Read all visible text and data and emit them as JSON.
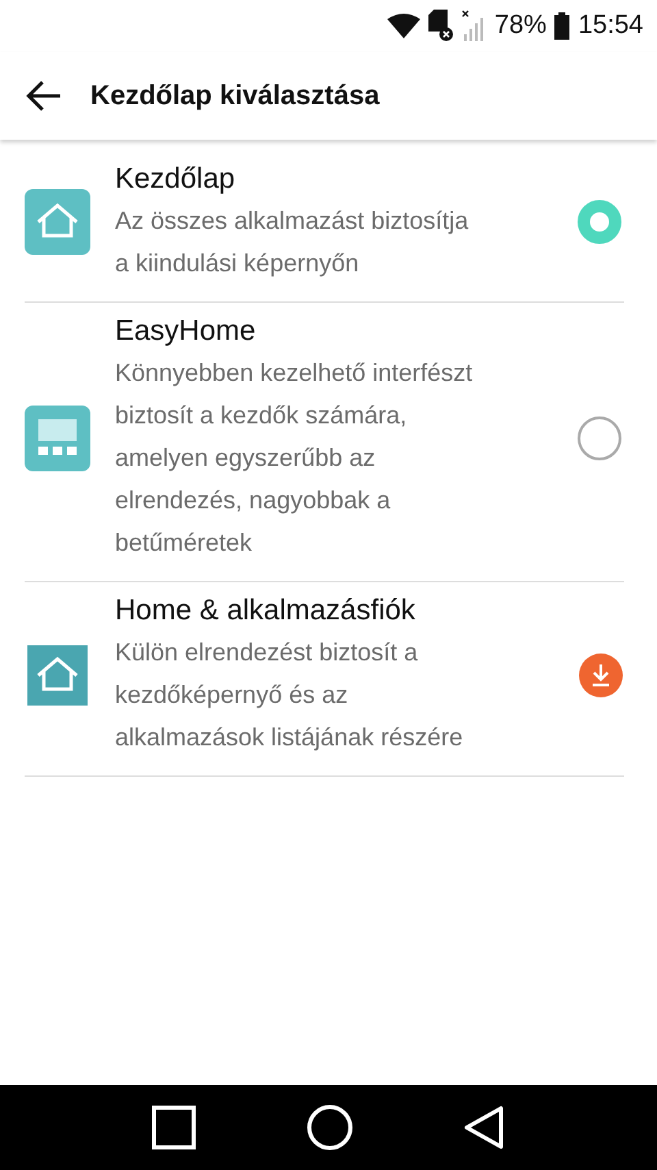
{
  "status_bar": {
    "battery": "78%",
    "time": "15:54"
  },
  "app_bar": {
    "title": "Kezdőlap kiválasztása"
  },
  "options": [
    {
      "title": "Kezdőlap",
      "description": "Az összes alkalmazást biztosítja a kiindulási képernyőn",
      "kind": "radio",
      "selected": true
    },
    {
      "title": "EasyHome",
      "description": "Könnyebben kezelhető interfészt biztosít a kezdők számára, amelyen egyszerűbb az elrendezés, nagyobbak a betűméretek",
      "kind": "radio",
      "selected": false
    },
    {
      "title": "Home & alkalmazásfiók",
      "description": "Külön elrendezést biztosít a kezdőképernyő és az alkalmazások listájának részére",
      "kind": "download"
    }
  ]
}
